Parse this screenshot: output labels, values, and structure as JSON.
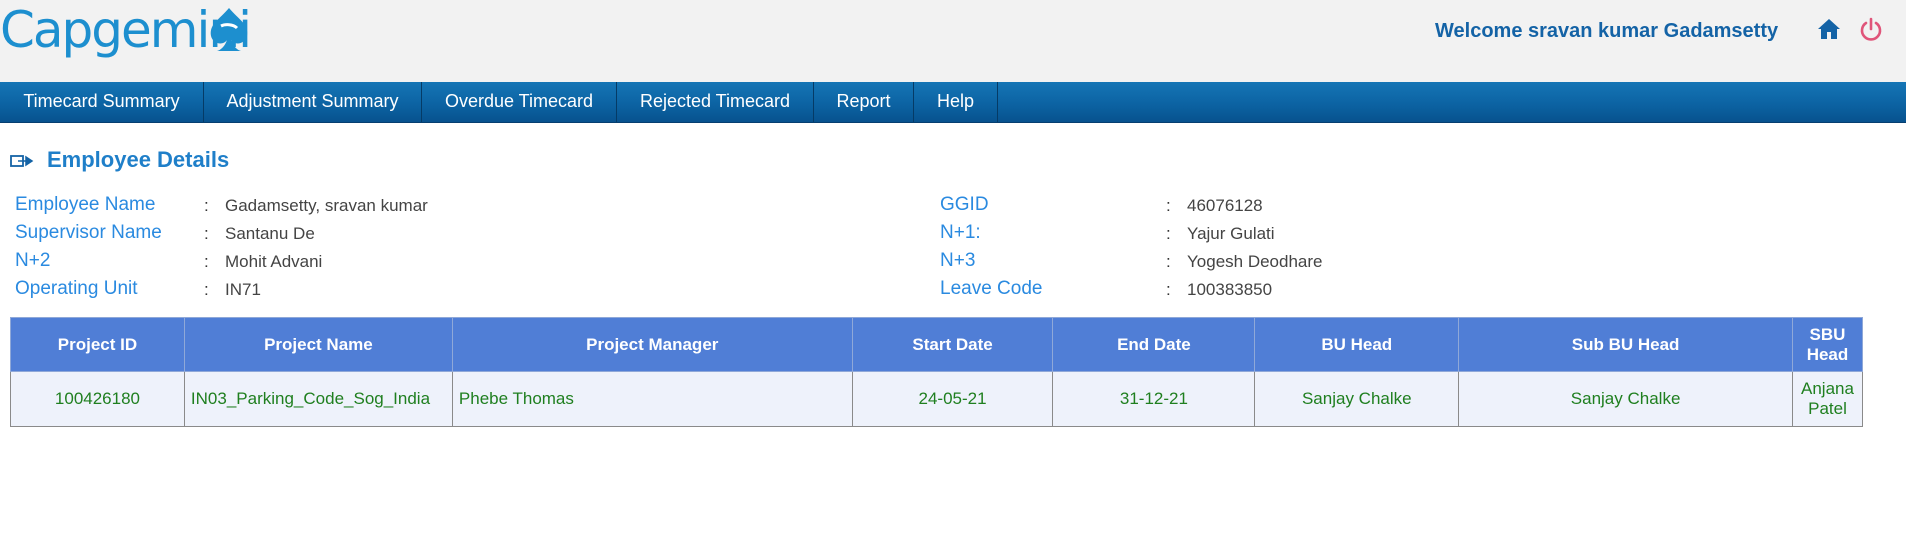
{
  "header": {
    "logo_text": "Capgemini",
    "welcome": "Welcome sravan kumar Gadamsetty"
  },
  "icons": {
    "home": "home-icon",
    "power": "power-icon",
    "section": "arrow-right-icon"
  },
  "colors": {
    "brand_blue": "#1d8fcf",
    "nav_blue": "#0c63a3",
    "table_header": "#507ed6",
    "row_text": "#1f7f1f",
    "power_red": "#e0557a"
  },
  "nav": {
    "items": [
      {
        "label": "Timecard Summary"
      },
      {
        "label": "Adjustment Summary"
      },
      {
        "label": "Overdue Timecard"
      },
      {
        "label": "Rejected Timecard"
      },
      {
        "label": "Report"
      },
      {
        "label": "Help"
      }
    ]
  },
  "section": {
    "title": "Employee Details"
  },
  "details": {
    "left": [
      {
        "label": "Employee Name",
        "value": "Gadamsetty, sravan kumar"
      },
      {
        "label": "Supervisor Name",
        "value": "Santanu De"
      },
      {
        "label": "N+2",
        "value": "Mohit Advani"
      },
      {
        "label": "Operating Unit",
        "value": "IN71"
      }
    ],
    "right": [
      {
        "label": "GGID",
        "value": "46076128"
      },
      {
        "label": "N+1:",
        "value": "Yajur Gulati"
      },
      {
        "label": "N+3",
        "value": "Yogesh Deodhare"
      },
      {
        "label": "Leave Code",
        "value": "100383850"
      }
    ],
    "separator": ":"
  },
  "table": {
    "columns": [
      "Project ID",
      "Project Name",
      "Project Manager",
      "Start Date",
      "End Date",
      "BU Head",
      "Sub BU Head",
      "SBU Head"
    ],
    "rows": [
      [
        "100426180",
        "IN03_Parking_Code_Sog_India",
        "Phebe Thomas",
        "24-05-21",
        "31-12-21",
        "Sanjay Chalke",
        "Sanjay Chalke",
        "Anjana Patel"
      ]
    ]
  }
}
